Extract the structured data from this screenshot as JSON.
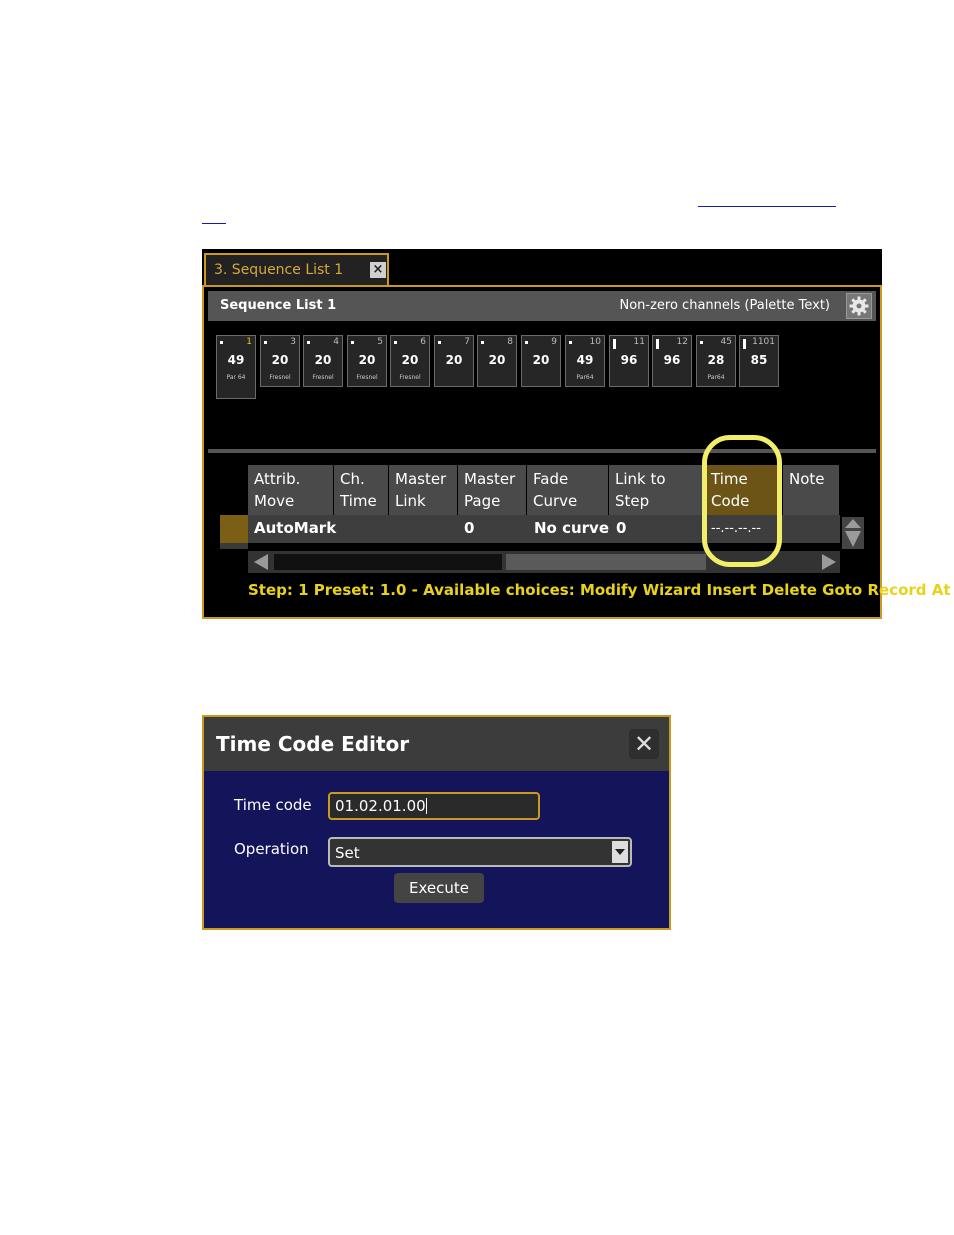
{
  "sequence_window": {
    "tab_label": "3. Sequence List 1",
    "tab_close": "×",
    "title": "Sequence List 1",
    "right_label": "Non-zero channels (Palette Text)",
    "channels": [
      {
        "num": "1",
        "value": "49",
        "label": "Par 64"
      },
      {
        "num": "3",
        "value": "20",
        "label": "Fresnel"
      },
      {
        "num": "4",
        "value": "20",
        "label": "Fresnel"
      },
      {
        "num": "5",
        "value": "20",
        "label": "Fresnel"
      },
      {
        "num": "6",
        "value": "20",
        "label": "Fresnel"
      },
      {
        "num": "7",
        "value": "20",
        "label": ""
      },
      {
        "num": "8",
        "value": "20",
        "label": ""
      },
      {
        "num": "9",
        "value": "20",
        "label": ""
      },
      {
        "num": "10",
        "value": "49",
        "label": "Par64"
      },
      {
        "num": "11",
        "value": "96",
        "label": ""
      },
      {
        "num": "12",
        "value": "96",
        "label": ""
      },
      {
        "num": "45",
        "value": "28",
        "label": "Par64"
      },
      {
        "num": "1101",
        "value": "85",
        "label": ""
      }
    ],
    "columns": [
      {
        "line1": "Attrib.",
        "line2": "Move"
      },
      {
        "line1": "Ch.",
        "line2": "Time"
      },
      {
        "line1": "Master",
        "line2": "Link"
      },
      {
        "line1": "Master",
        "line2": "Page"
      },
      {
        "line1": "Fade",
        "line2": "Curve"
      },
      {
        "line1": "Link to",
        "line2": "Step"
      },
      {
        "line1": "Time",
        "line2": "Code"
      },
      {
        "line1": "Note",
        "line2": ""
      }
    ],
    "row": {
      "attrib_move": "AutoMark",
      "master_page": "0",
      "fade_curve": "No curve",
      "link_to_step": "0",
      "time_code": "--.--.--.--"
    },
    "status": "Step: 1 Preset: 1.0 - Available choices: Modify Wizard Insert Delete Goto Record At"
  },
  "time_code_editor": {
    "title": "Time Code Editor",
    "close": "✕",
    "time_code_label": "Time code",
    "time_code_value": "01.02.01.00",
    "operation_label": "Operation",
    "operation_value": "Set",
    "execute_label": "Execute"
  },
  "colors": {
    "accent": "#c99a1e",
    "status_text": "#e8d21a",
    "dialog_bg": "#14145a",
    "highlight": "#f2ee6a"
  }
}
